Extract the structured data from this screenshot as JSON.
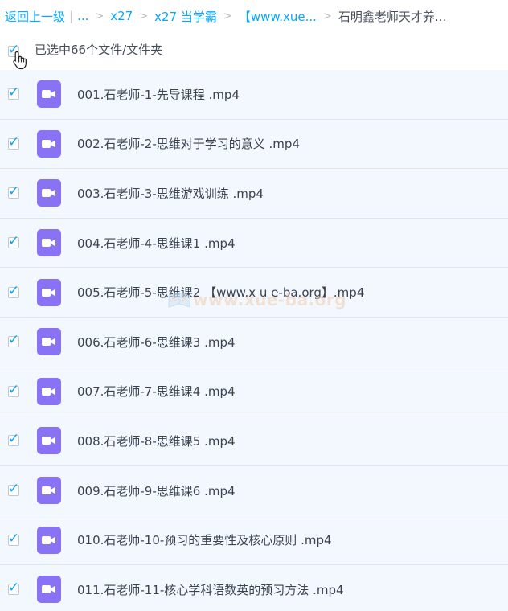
{
  "breadcrumb": {
    "back": "返回上一级",
    "separator_bar": "|",
    "ellipsis": "...",
    "separator": ">",
    "items": [
      "x27",
      "x27 当学霸",
      "【www.xue...",
      "石明鑫老师天才养..."
    ]
  },
  "selection": {
    "text": "已选中66个文件/文件夹"
  },
  "files": [
    "001.石老师-1-先导课程 .mp4",
    "002.石老师-2-思维对于学习的意义 .mp4",
    "003.石老师-3-思维游戏训练 .mp4",
    "004.石老师-4-思维课1 .mp4",
    "005.石老师-5-思维课2 【www.x u e-ba.org】.mp4",
    "006.石老师-6-思维课3 .mp4",
    "007.石老师-7-思维课4 .mp4",
    "008.石老师-8-思维课5 .mp4",
    "009.石老师-9-思维课6 .mp4",
    "010.石老师-10-预习的重要性及核心原则 .mp4",
    "011.石老师-11-核心学科语数英的预习方法 .mp4"
  ],
  "watermark": {
    "text": "www.xue-ba.org"
  },
  "icons": {
    "checkbox": "checkmark-icon",
    "file": "video-file-icon",
    "cursor": "hand-pointer-icon"
  },
  "colors": {
    "accent": "#06a7ff",
    "row_bg": "#f3f8ff",
    "video_icon": "#8a72f5",
    "text": "#3b4350"
  }
}
